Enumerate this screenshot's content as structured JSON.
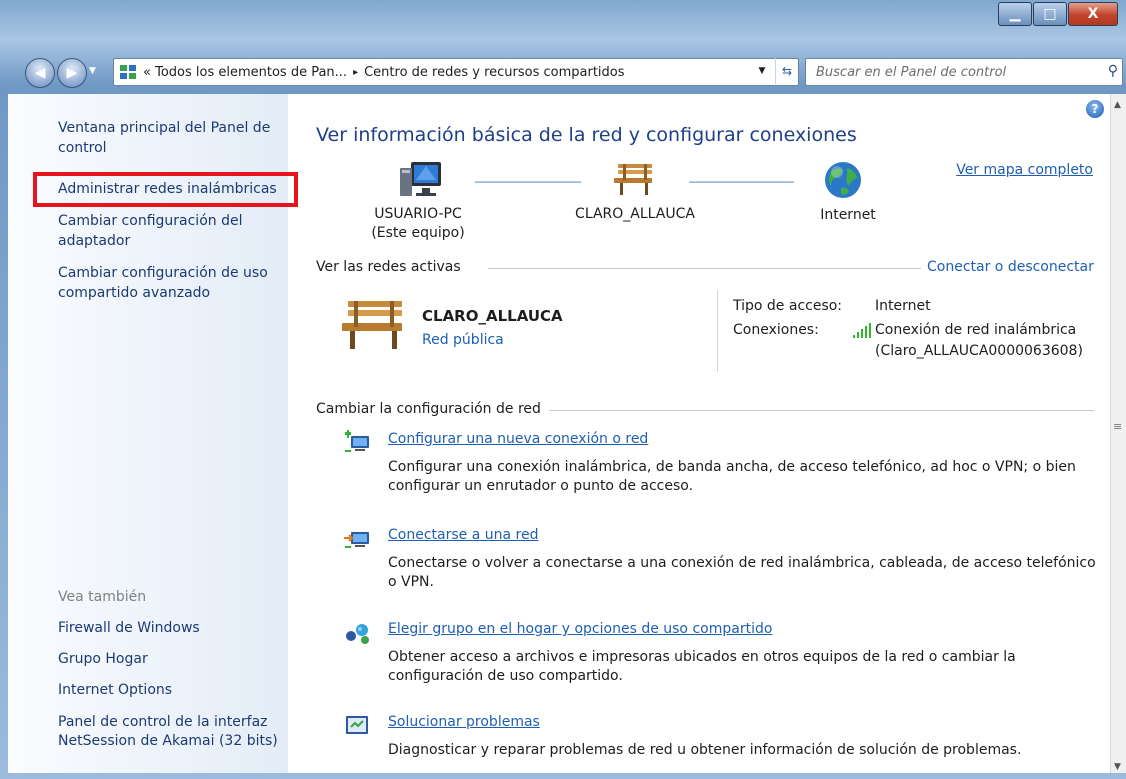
{
  "window": {
    "minimize_label": "▁",
    "maximize_label": "□",
    "close_label": "X"
  },
  "address_bar": {
    "breadcrumb": "« Todos los elementos de Pan...",
    "separator": "▸",
    "current": "Centro de redes y recursos compartidos"
  },
  "search": {
    "placeholder": "Buscar en el Panel de control"
  },
  "sidebar": {
    "items": [
      "Ventana principal del Panel de control",
      "Administrar redes inalámbricas",
      "Cambiar configuración del adaptador",
      "Cambiar configuración de uso compartido avanzado"
    ],
    "see_also_label": "Vea también",
    "see_also": [
      "Firewall de Windows",
      "Grupo Hogar",
      "Internet Options",
      "Panel de control de la interfaz NetSession de Akamai (32 bits)"
    ]
  },
  "main": {
    "title": "Ver información básica de la red y configurar conexiones",
    "map_link": "Ver mapa completo",
    "nodes": [
      {
        "label": "USUARIO-PC",
        "sublabel": "(Este equipo)",
        "icon": "computer-icon"
      },
      {
        "label": "CLARO_ALLAUCA",
        "sublabel": "",
        "icon": "bench-icon"
      },
      {
        "label": "Internet",
        "sublabel": "",
        "icon": "globe-icon"
      }
    ],
    "active_networks": {
      "heading": "Ver las redes activas",
      "connect_link": "Conectar o desconectar",
      "network_name": "CLARO_ALLAUCA",
      "network_type": "Red pública",
      "access_type_label": "Tipo de acceso:",
      "access_type_value": "Internet",
      "connections_label": "Conexiones:",
      "connection_link": "Conexión de red inalámbrica",
      "connection_link_2": "(Claro_ALLAUCA0000063608)"
    },
    "change_settings": {
      "heading": "Cambiar la configuración de red",
      "tasks": [
        {
          "title": "Configurar una nueva conexión o red",
          "description": "Configurar una conexión inalámbrica, de banda ancha, de acceso telefónico, ad hoc o VPN; o bien configurar un enrutador o punto de acceso.",
          "icon": "new-connection-icon"
        },
        {
          "title": "Conectarse a una red",
          "description": "Conectarse o volver a conectarse a una conexión de red inalámbrica, cableada, de acceso telefónico o VPN.",
          "icon": "connect-network-icon"
        },
        {
          "title": "Elegir grupo en el hogar y opciones de uso compartido",
          "description": "Obtener acceso a archivos e impresoras ubicados en otros equipos de la red o cambiar la configuración de uso compartido.",
          "icon": "homegroup-icon"
        },
        {
          "title": "Solucionar problemas",
          "description": "Diagnosticar y reparar problemas de red u obtener información de solución de problemas.",
          "icon": "troubleshoot-icon"
        }
      ]
    }
  }
}
